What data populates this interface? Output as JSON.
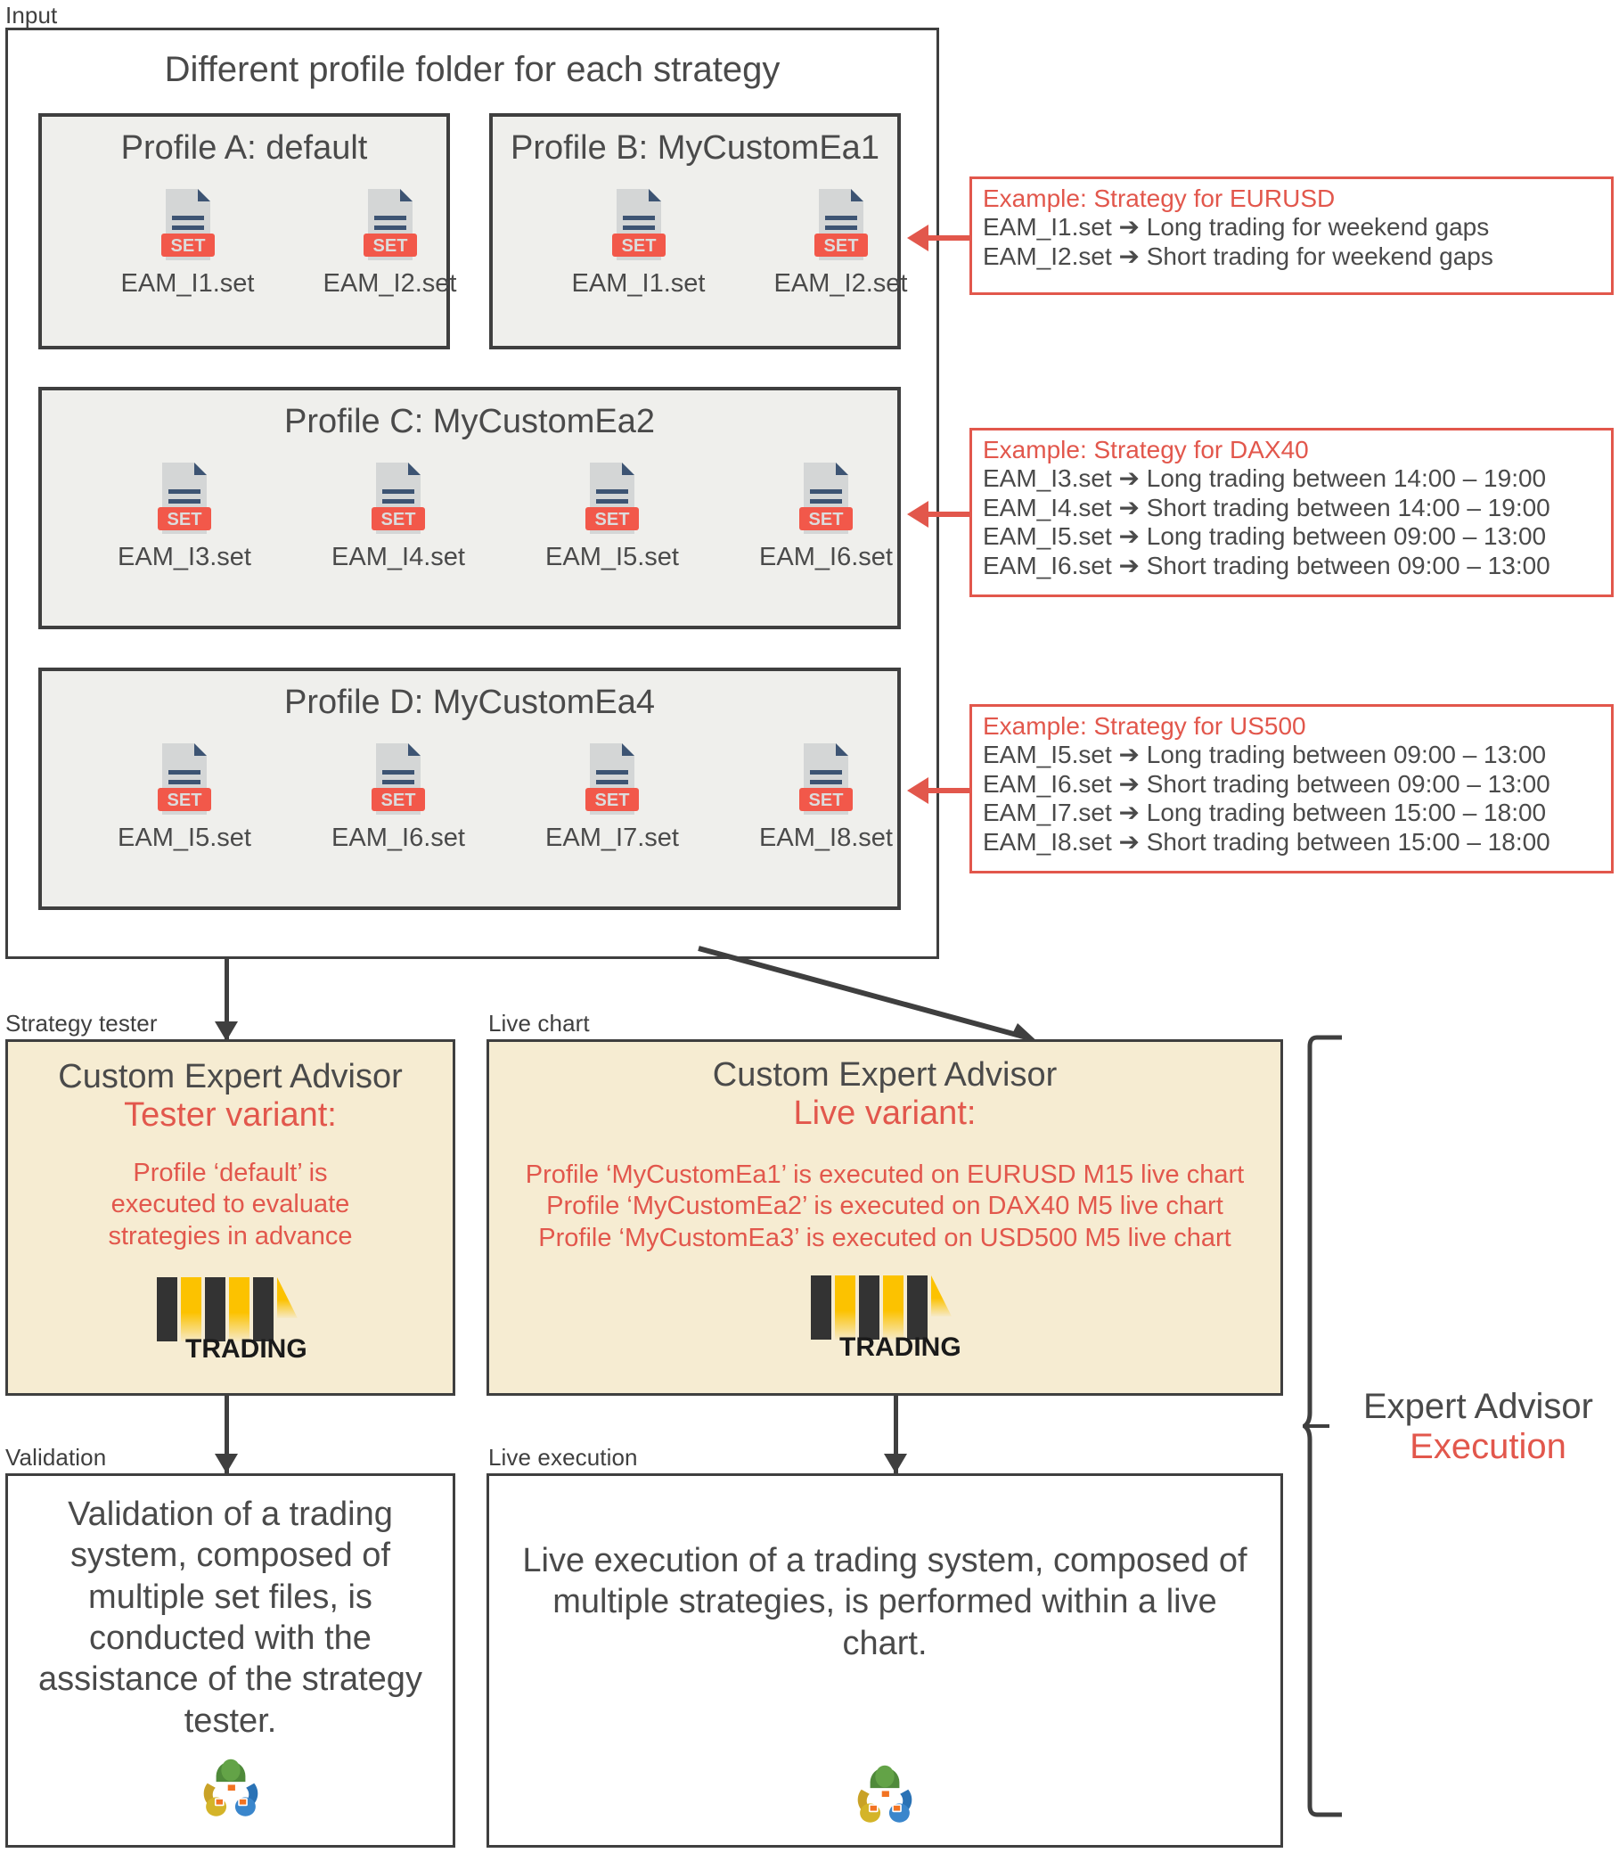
{
  "labels": {
    "input": "Input",
    "strategy_tester": "Strategy tester",
    "live_chart": "Live chart",
    "validation": "Validation",
    "live_execution": "Live execution"
  },
  "input_section": {
    "title": "Different profile folder for each strategy",
    "profiles": [
      {
        "title": "Profile A: default",
        "files": [
          "EAM_I1.set",
          "EAM_I2.set"
        ]
      },
      {
        "title": "Profile B: MyCustomEa1",
        "files": [
          "EAM_I1.set",
          "EAM_I2.set"
        ]
      },
      {
        "title": "Profile C: MyCustomEa2",
        "files": [
          "EAM_I3.set",
          "EAM_I4.set",
          "EAM_I5.set",
          "EAM_I6.set"
        ]
      },
      {
        "title": "Profile D: MyCustomEa4",
        "files": [
          "EAM_I5.set",
          "EAM_I6.set",
          "EAM_I7.set",
          "EAM_I8.set"
        ]
      }
    ]
  },
  "notes": [
    {
      "title": "Example: Strategy for EURUSD",
      "lines": [
        "EAM_I1.set ➔ Long trading for weekend gaps",
        "EAM_I2.set ➔ Short trading for weekend gaps"
      ]
    },
    {
      "title": "Example: Strategy for DAX40",
      "lines": [
        "EAM_I3.set ➔ Long trading between 14:00 – 19:00",
        "EAM_I4.set ➔ Short trading between 14:00 – 19:00",
        "EAM_I5.set ➔ Long trading between 09:00 – 13:00",
        "EAM_I6.set ➔ Short trading between 09:00 – 13:00"
      ]
    },
    {
      "title": "Example: Strategy for US500",
      "lines": [
        "EAM_I5.set ➔ Long trading between 09:00 – 13:00",
        "EAM_I6.set ➔ Short trading between 09:00 – 13:00",
        "EAM_I7.set ➔ Long trading between 15:00 – 18:00",
        "EAM_I8.set ➔ Short trading between 15:00 – 18:00"
      ]
    }
  ],
  "tester_ea": {
    "title": "Custom Expert Advisor",
    "variant": "Tester variant:",
    "description": "Profile ‘default’ is executed to evaluate strategies in advance",
    "logo_text": "TRADING"
  },
  "live_ea": {
    "title": "Custom Expert Advisor",
    "variant": "Live variant:",
    "lines": [
      "Profile ‘MyCustomEa1’ is executed on EURUSD M15 live chart",
      "Profile ‘MyCustomEa2’ is executed on DAX40 M5 live chart",
      "Profile ‘MyCustomEa3’ is executed on USD500 M5 live chart"
    ],
    "logo_text": "TRADING"
  },
  "validation_box": {
    "text": "Validation of a trading system, composed of multiple set files, is conducted with the assistance of the strategy tester."
  },
  "live_execution_box": {
    "text": "Live execution of a trading system, composed of multiple strategies, is performed within a live chart."
  },
  "bracket": {
    "line1": "Expert Advisor",
    "line2": "Execution"
  },
  "colors": {
    "accent_red": "#e2574c",
    "dark": "#3f3f3f",
    "profile_bg": "#efefec",
    "ea_bg": "#f6ecd2",
    "set_badge": "#f2584a",
    "doc_gray": "#d4d6d6",
    "doc_navy": "#3d5473",
    "logo_yellow": "#fcc200"
  }
}
